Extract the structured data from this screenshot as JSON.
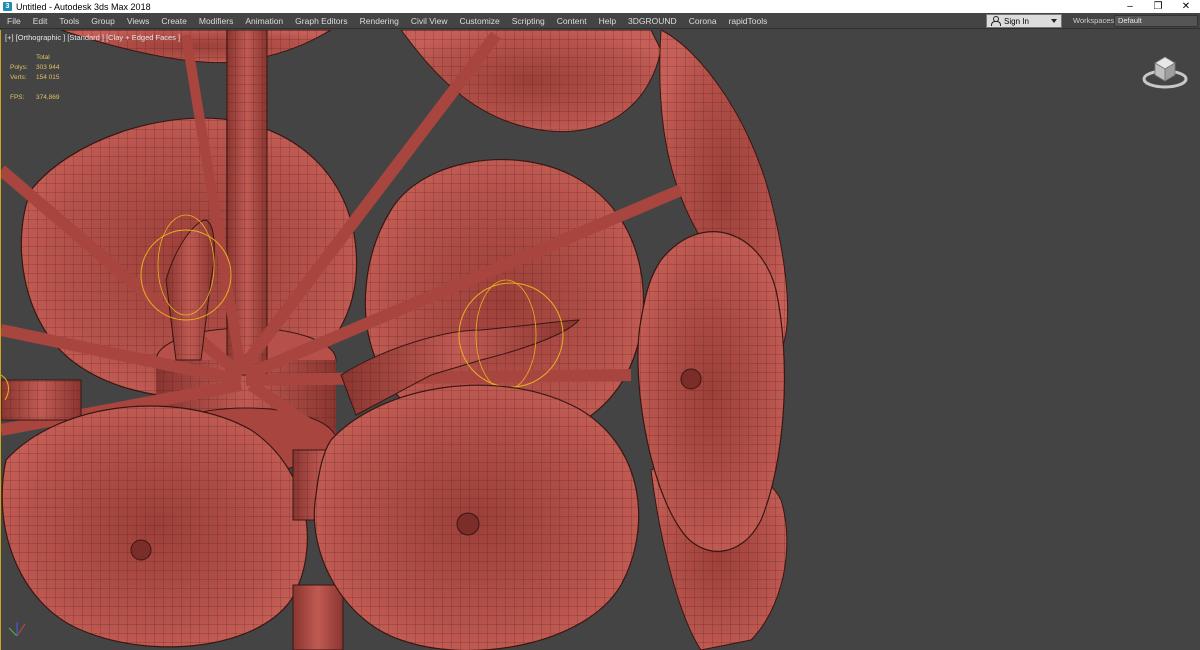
{
  "window": {
    "title": "Untitled - Autodesk 3ds Max 2018",
    "controls": {
      "minimize": "–",
      "restore": "❐",
      "close": "✕"
    }
  },
  "menu": {
    "items": [
      "File",
      "Edit",
      "Tools",
      "Group",
      "Views",
      "Create",
      "Modifiers",
      "Animation",
      "Graph Editors",
      "Rendering",
      "Civil View",
      "Customize",
      "Scripting",
      "Content",
      "Help",
      "3DGROUND",
      "Corona",
      "rapidTools"
    ],
    "sign_in": "Sign In",
    "workspaces_label": "Workspaces:",
    "workspaces_value": "Default"
  },
  "viewport": {
    "label": "[+] [Orthographic ] [Standard ] [Clay + Edged Faces ]",
    "stats": {
      "total_label": "Total",
      "polys_label": "Polys:",
      "polys_value": "303 944",
      "verts_label": "Verts:",
      "verts_value": "154 015",
      "fps_label": "FPS:",
      "fps_value": "374,869"
    }
  },
  "colors": {
    "viewport_bg": "#444444",
    "clay": "#b5504a",
    "clay_dark": "#8a3530",
    "wire": "#3a1612",
    "selection": "#e8b020"
  },
  "icons": {
    "app": "3ds-max-icon",
    "viewcube": "viewcube-icon",
    "axis": "axis-tripod-icon"
  }
}
